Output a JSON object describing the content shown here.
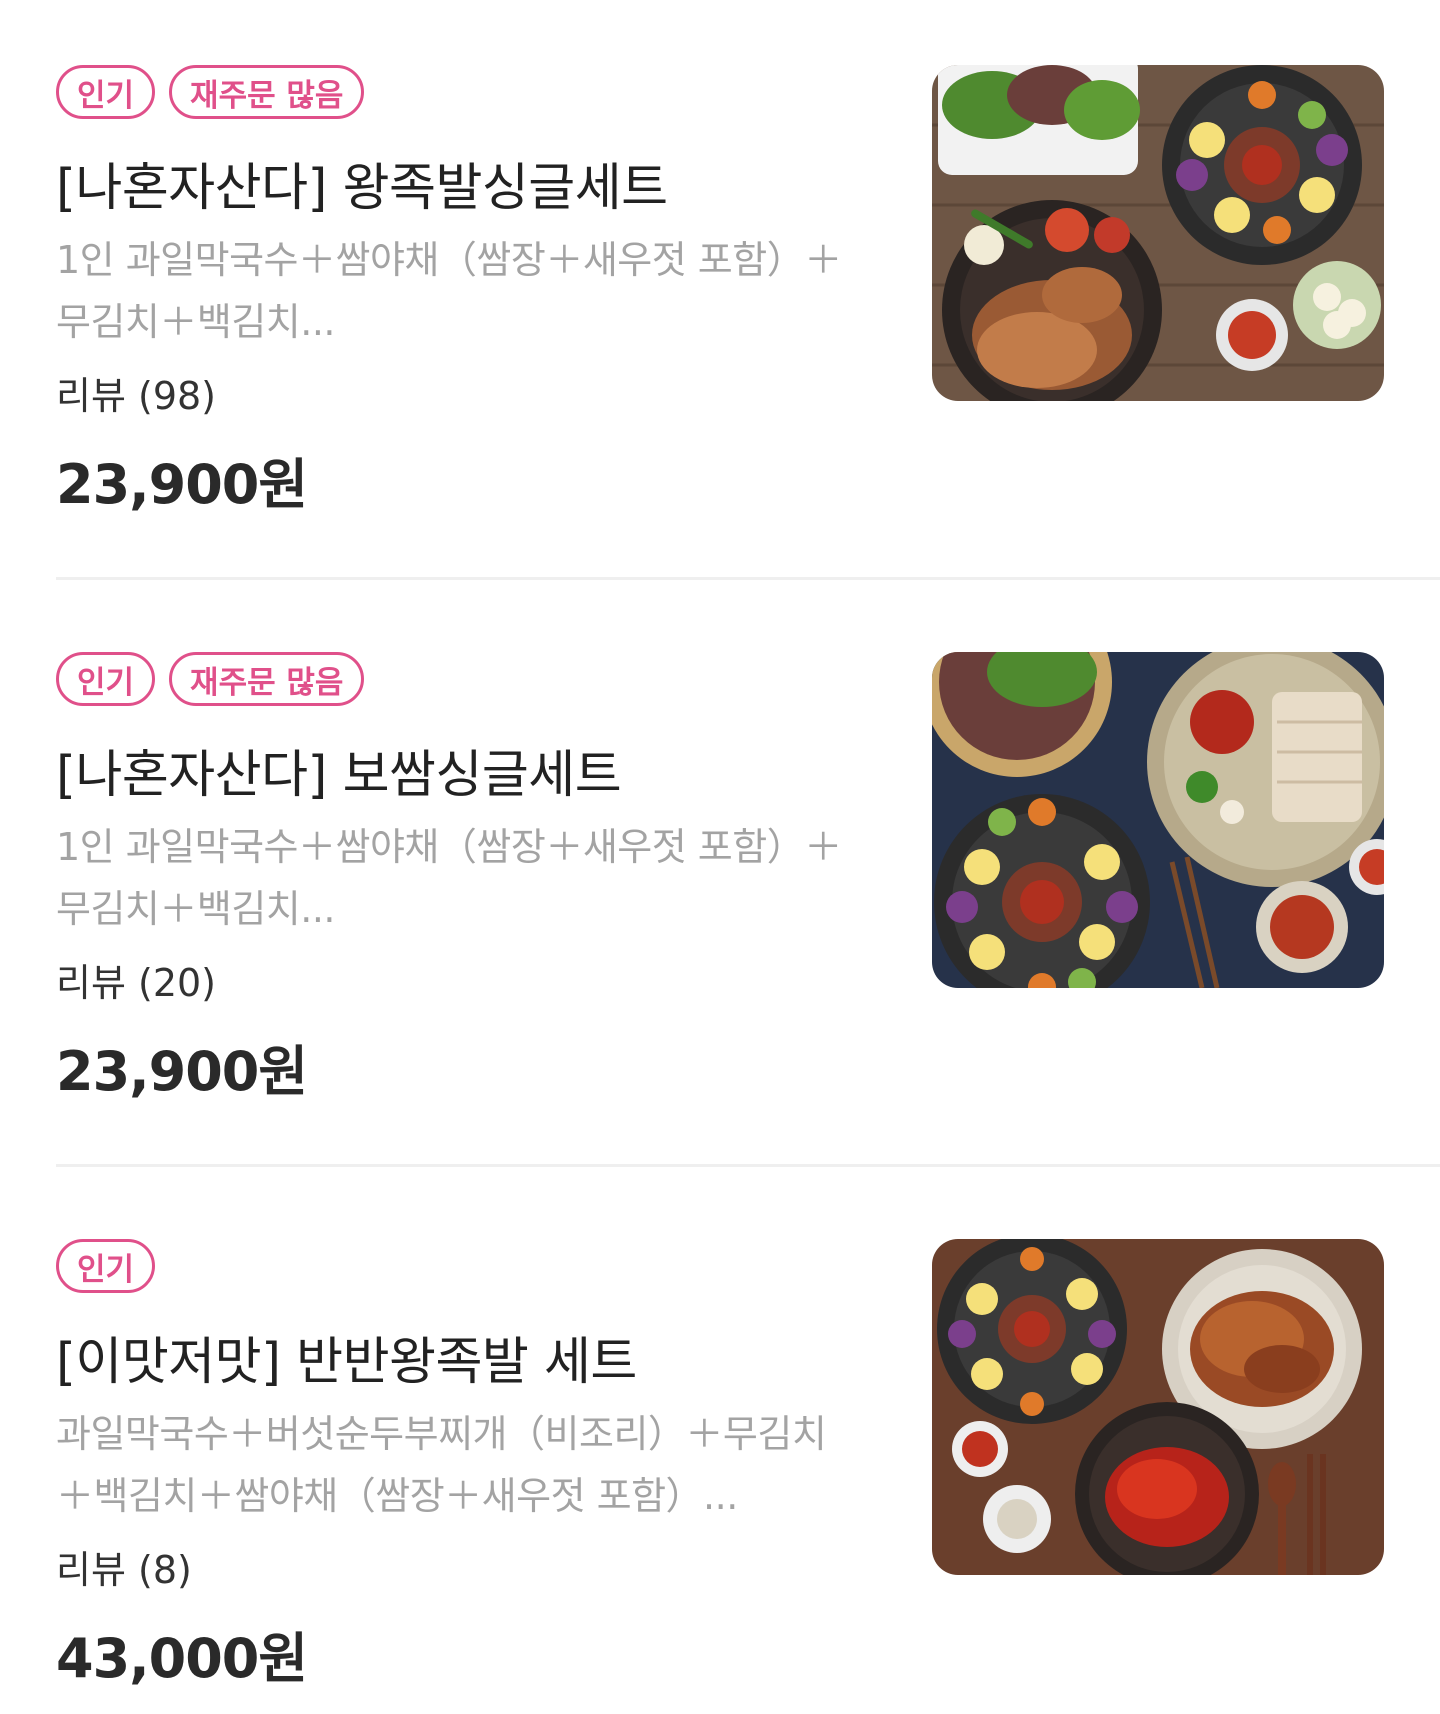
{
  "menu_items": [
    {
      "badges": [
        "인기",
        "재주문 많음"
      ],
      "title": "[나혼자산다] 왕족발싱글세트",
      "description": "1인 과일막국수＋쌈야채（쌈장＋새우젓 포함）＋무김치＋백김치...",
      "review": "리뷰 (98)",
      "price": "23,900원",
      "image_icon": "jokbal-set-photo"
    },
    {
      "badges": [
        "인기",
        "재주문 많음"
      ],
      "title": "[나혼자산다] 보쌈싱글세트",
      "description": "1인 과일막국수＋쌈야채（쌈장＋새우젓 포함）＋무김치＋백김치...",
      "review": "리뷰 (20)",
      "price": "23,900원",
      "image_icon": "bossam-set-photo"
    },
    {
      "badges": [
        "인기"
      ],
      "title": "[이맛저맛] 반반왕족발 세트",
      "description": "과일막국수＋버섯순두부찌개（비조리）＋무김치＋백김치＋쌈야채（쌈장＋새우젓 포함）...",
      "review": "리뷰 (8)",
      "price": "43,000원",
      "image_icon": "half-half-jokbal-photo"
    }
  ],
  "colors": {
    "badge_accent": "#e0508a",
    "description_text": "#a3a3a3",
    "divider": "#efefef"
  }
}
